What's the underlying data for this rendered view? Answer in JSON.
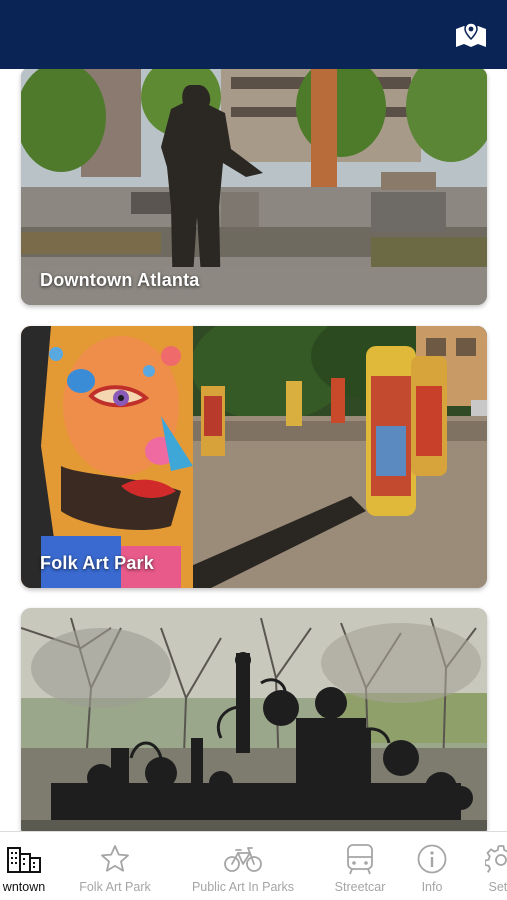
{
  "header": {
    "map_icon": "map-marker-icon",
    "background": "#0a2456"
  },
  "cards": [
    {
      "title": "Downtown Atlanta"
    },
    {
      "title": "Folk Art Park"
    },
    {
      "title": ""
    }
  ],
  "tabs": [
    {
      "label": "Downtown",
      "visible_label": "wntown",
      "icon": "city-buildings-icon",
      "active": true
    },
    {
      "label": "Folk Art Park",
      "icon": "star-icon",
      "active": false
    },
    {
      "label": "Public Art In Parks",
      "icon": "bicycle-icon",
      "active": false
    },
    {
      "label": "Streetcar",
      "icon": "streetcar-icon",
      "active": false
    },
    {
      "label": "Info",
      "icon": "info-icon",
      "active": false
    },
    {
      "label": "Settings",
      "visible_label": "Setti",
      "icon": "gear-icon",
      "active": false
    }
  ],
  "colors": {
    "tab_inactive": "#a5a5a5",
    "tab_active": "#111111"
  }
}
